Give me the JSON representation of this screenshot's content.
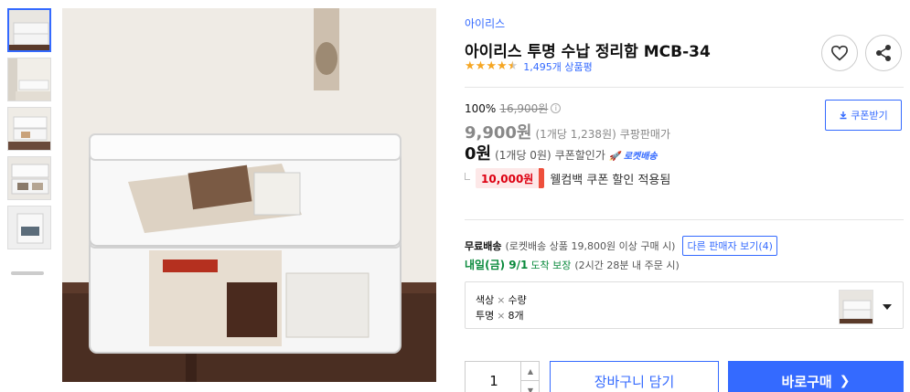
{
  "thumbnails": [
    {
      "name": "thumb-1",
      "active": true
    },
    {
      "name": "thumb-2",
      "active": false
    },
    {
      "name": "thumb-3",
      "active": false
    },
    {
      "name": "thumb-4",
      "active": false
    },
    {
      "name": "thumb-5",
      "active": false
    },
    {
      "name": "thumb-6",
      "active": false
    }
  ],
  "product": {
    "brand": "아이리스",
    "title": "아이리스 투명 수납 정리함 MCB-34",
    "rating_stars": 4.5,
    "review_count": "1,495개 상품평"
  },
  "pricing": {
    "discount_rate": "100%",
    "original_price": "16,900원",
    "sale_price": "9,900원",
    "sale_unit": "(1개당 1,238원)",
    "sale_label": "쿠팡판매가",
    "coupon_price": "0원",
    "coupon_unit": "(1개당 0원)",
    "coupon_label": "쿠폰할인가",
    "rocket_badge": "로켓배송",
    "coupon_button": "쿠폰받기",
    "welcome_amount": "10,000원",
    "welcome_text": "웰컴백 쿠폰 할인 적용됨"
  },
  "shipping": {
    "label": "무료배송",
    "condition": "(로켓배송 상품 19,800원 이상 구매 시)",
    "other_sellers": "다른 판매자 보기(4)",
    "arrival_date": "내일(금) 9/1",
    "arrival_text": "도착 보장",
    "arrival_detail": "(2시간 28분 내 주문 시)"
  },
  "option": {
    "header_color": "색상",
    "header_qty": "수량",
    "value_color": "투명",
    "value_qty": "8개",
    "separator": "×"
  },
  "purchase": {
    "quantity": "1",
    "cart_label": "장바구니 담기",
    "buy_label": "바로구매",
    "buy_chevron": "❯"
  },
  "colors": {
    "accent": "#346aff",
    "star": "#f5a623",
    "discount_red": "#d01",
    "arrival_green": "#0a8a3c"
  },
  "icons": [
    "heart-icon",
    "share-icon",
    "info-icon",
    "download-icon",
    "rocket-icon",
    "chevron-up-icon",
    "chevron-down-icon",
    "caret-down-icon"
  ]
}
